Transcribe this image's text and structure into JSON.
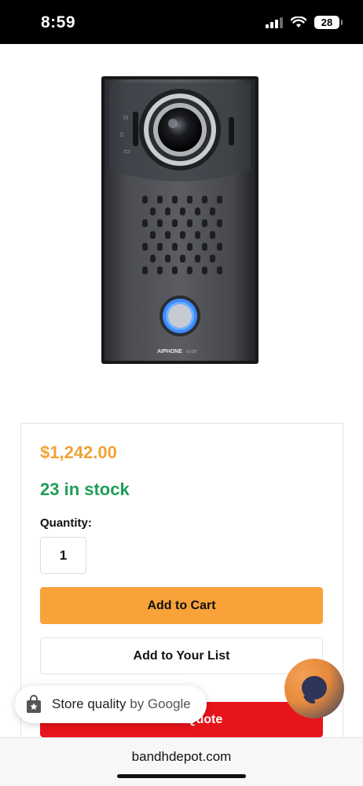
{
  "status_bar": {
    "time": "8:59",
    "battery": "28"
  },
  "product": {
    "brand_mark": "AIPHONE",
    "model_mark": "IX-DV",
    "price": "$1,242.00",
    "stock": "23 in stock",
    "quantity_label": "Quantity:",
    "quantity_value": "1"
  },
  "actions": {
    "add_to_cart": "Add to Cart",
    "add_to_list": "Add to Your List",
    "add_to_quote": "Add To Quote"
  },
  "google_badge": {
    "label": "Store quality",
    "by": "by Google"
  },
  "browser": {
    "url": "bandhdepot.com"
  },
  "colors": {
    "price": "#f0a335",
    "stock": "#1e9e57",
    "cart": "#f9a23a",
    "quote": "#e8141b"
  }
}
